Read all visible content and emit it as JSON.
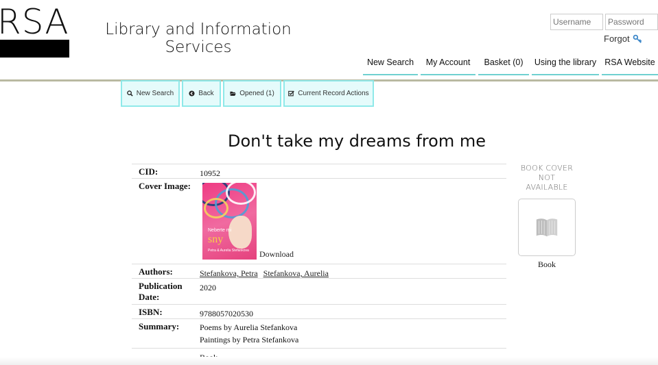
{
  "brand": {
    "logo_text": "RSA",
    "site_title": "Library and Information Services"
  },
  "login": {
    "username_placeholder": "Username",
    "password_placeholder": "Password",
    "forgot_label": "Forgot"
  },
  "topnav": [
    {
      "label": "New Search"
    },
    {
      "label": "My Account"
    },
    {
      "label": "Basket (0)"
    },
    {
      "label": "Using the library"
    },
    {
      "label": "RSA Website"
    }
  ],
  "toolbar": [
    {
      "label": "New Search",
      "icon": "search-icon"
    },
    {
      "label": "Back",
      "icon": "back-icon"
    },
    {
      "label": "Opened (1)",
      "icon": "folder-open-icon"
    },
    {
      "label": "Current Record Actions",
      "icon": "checkbox-icon"
    }
  ],
  "record": {
    "title": "Don't take my dreams from me",
    "cid_label": "CID:",
    "cid": "10952",
    "cover_label": "Cover Image:",
    "cover_text": {
      "line1": "Neberte mi",
      "line2": "sny",
      "line3": "Petra & Aurelia Stefankova"
    },
    "download_label": "Download",
    "authors_label": "Authors:",
    "authors": [
      "Stefankova, Petra",
      "Stefankova, Aurelia"
    ],
    "pubdate_label": "Publication Date:",
    "pubdate": "2020",
    "isbn_label": "ISBN:",
    "isbn": "9788057020530",
    "summary_label": "Summary:",
    "summary_lines": [
      "Poems by Aurelia Stefankova",
      "Paintings by Petra Stefankova"
    ],
    "format": "Book"
  },
  "side": {
    "no_cover_line1": "BOOK COVER",
    "no_cover_line2": "NOT AVAILABLE",
    "type_label": "Book"
  },
  "colors": {
    "accent": "#6fd0d0",
    "toolbar_bg": "#e5fbfb",
    "toolbar_border": "#8fe9e9",
    "rule": "#b9b9a1"
  }
}
